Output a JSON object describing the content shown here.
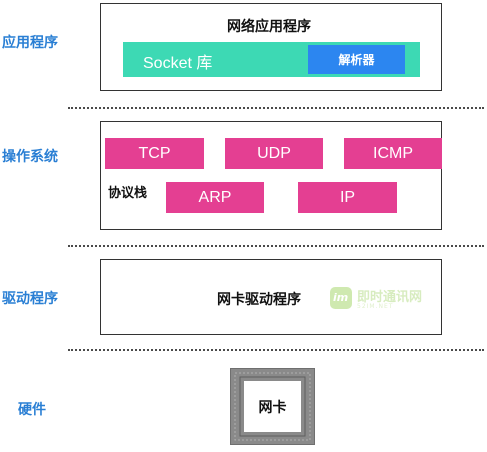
{
  "layers": {
    "application": "应用程序",
    "os": "操作系统",
    "driver": "驱动程序",
    "hardware": "硬件"
  },
  "application_box": {
    "title": "网络应用程序",
    "socket_library": "Socket 库",
    "parser": "解析器"
  },
  "os_box": {
    "stack_label": "协议栈",
    "protocols_top": [
      "TCP",
      "UDP",
      "ICMP"
    ],
    "protocols_bottom": [
      "ARP",
      "IP"
    ]
  },
  "driver_box": {
    "title": "网卡驱动程序"
  },
  "hardware_box": {
    "title": "网卡"
  },
  "watermark": {
    "logo": "im",
    "text": "即时通讯网",
    "sub": "52IM.NET"
  },
  "colors": {
    "layer_label": "#2a7fd4",
    "socket_bar": "#3dd9b4",
    "parser": "#2c86f0",
    "protocol": "#e43f92",
    "nic_frame": "#8a8a8a"
  }
}
